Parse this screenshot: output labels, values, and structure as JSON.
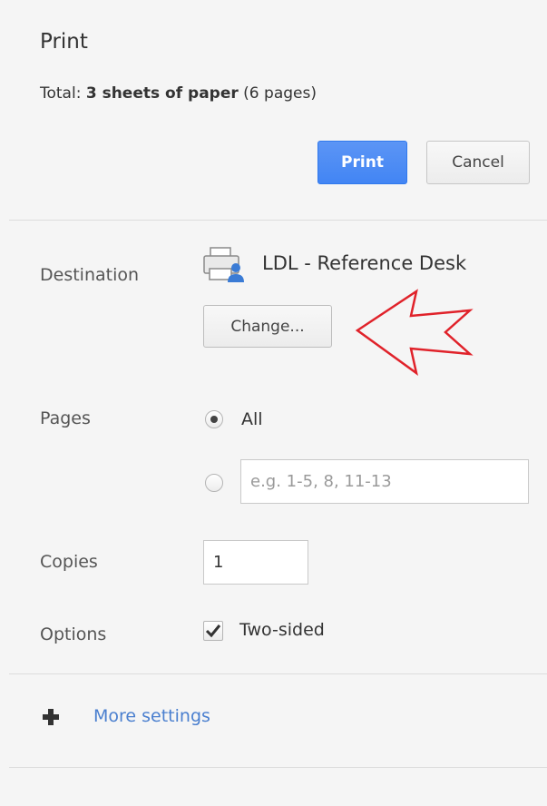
{
  "header": {
    "title": "Print",
    "total_prefix": "Total:",
    "total_bold": "3 sheets of paper",
    "total_suffix": "(6 pages)",
    "print_label": "Print",
    "cancel_label": "Cancel"
  },
  "destination": {
    "label": "Destination",
    "printer_name": "LDL - Reference Desk",
    "change_label": "Change..."
  },
  "pages": {
    "label": "Pages",
    "all_label": "All",
    "all_selected": true,
    "range_placeholder": "e.g. 1-5, 8, 11-13",
    "range_value": ""
  },
  "copies": {
    "label": "Copies",
    "value": "1"
  },
  "options": {
    "label": "Options",
    "two_sided_label": "Two-sided",
    "two_sided_checked": true
  },
  "more_settings": {
    "label": "More settings"
  },
  "colors": {
    "accent": "#4285f4",
    "link": "#4a7fcf",
    "arrow": "#e0222a"
  }
}
